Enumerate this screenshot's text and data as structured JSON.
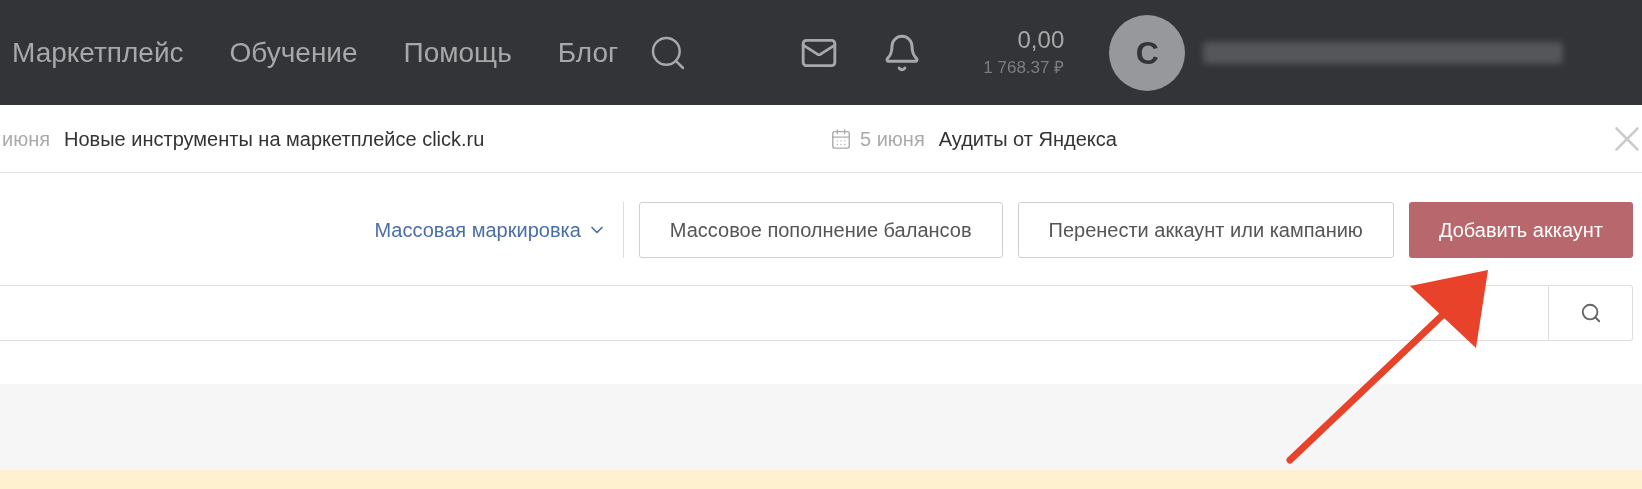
{
  "header": {
    "nav": [
      {
        "label": "Маркетплейс"
      },
      {
        "label": "Обучение"
      },
      {
        "label": "Помощь"
      },
      {
        "label": "Блог"
      }
    ],
    "balance": {
      "amount": "0,00",
      "secondary": "1 768.37 ₽"
    },
    "avatar": {
      "initial": "C"
    }
  },
  "news": [
    {
      "date": "июня",
      "title": "Новые инструменты на маркетплейсе click.ru",
      "calendar": false
    },
    {
      "date": "5 июня",
      "title": "Аудиты от Яндекса",
      "calendar": true
    }
  ],
  "toolbar": {
    "dropdown": "Массовая маркировка",
    "buttons": [
      {
        "label": "Массовое пополнение балансов",
        "kind": "outline"
      },
      {
        "label": "Перенести аккаунт или кампанию",
        "kind": "outline"
      },
      {
        "label": "Добавить аккаунт",
        "kind": "primary"
      }
    ]
  }
}
